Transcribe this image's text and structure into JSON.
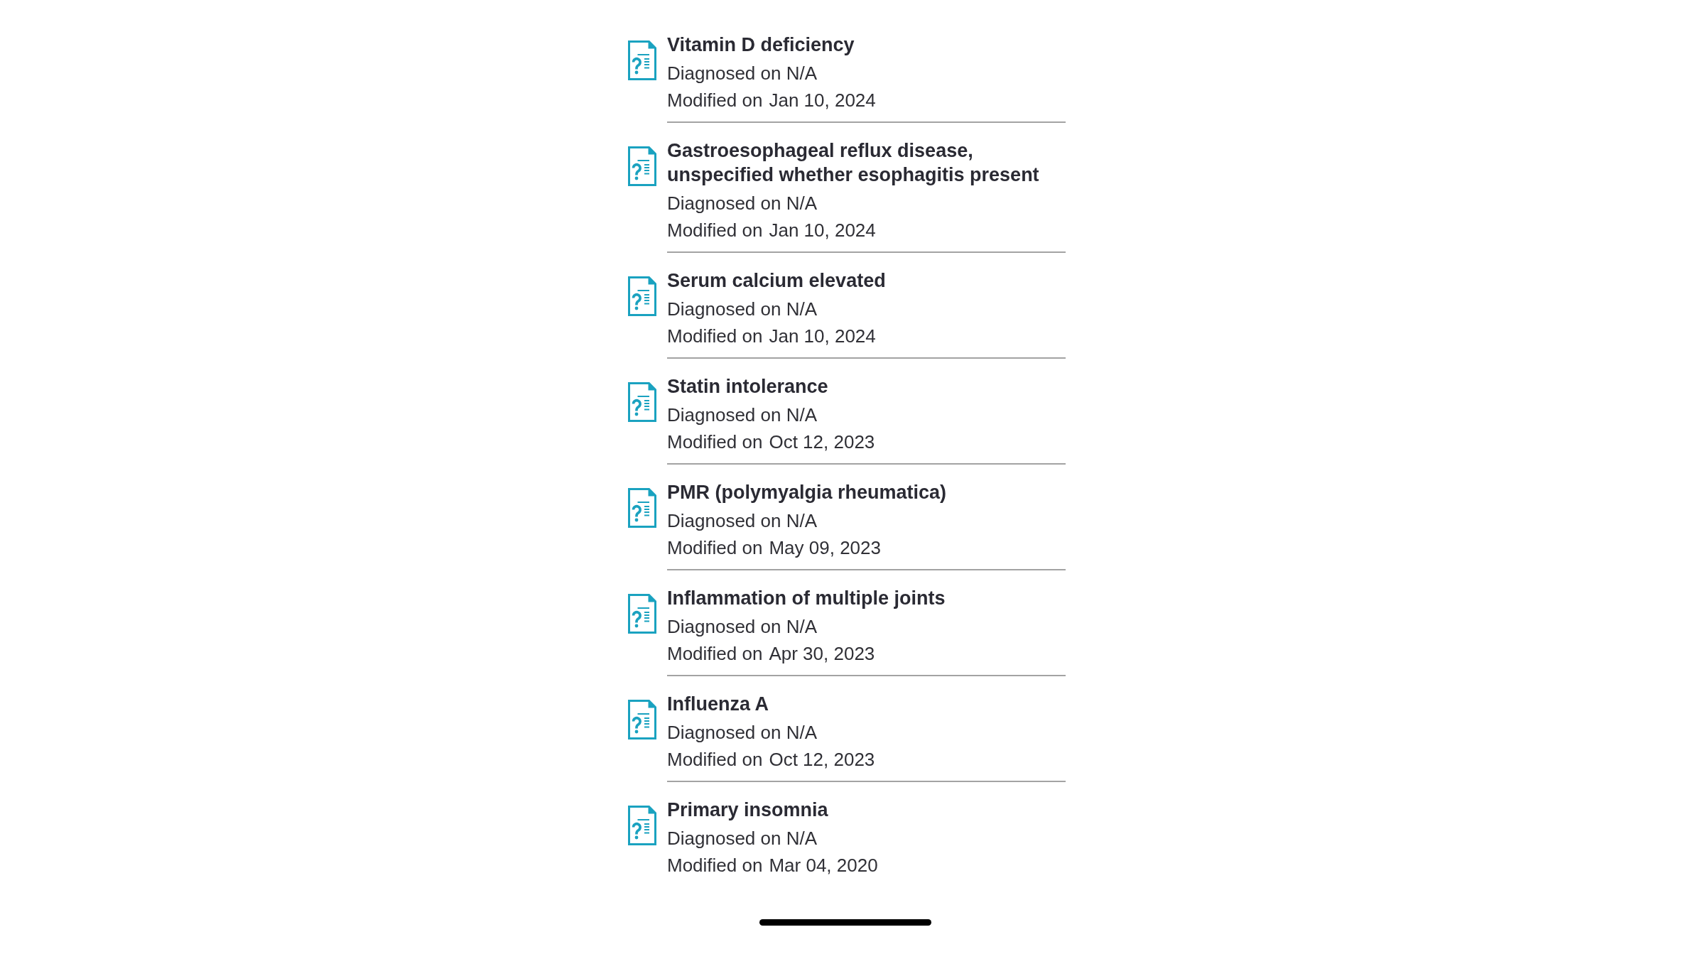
{
  "conditions": [
    {
      "title": "Vitamin D deficiency",
      "diagnosed": "Diagnosed on N/A",
      "modified_label": "Modified on",
      "modified_date": "Jan 10, 2024"
    },
    {
      "title": "Gastroesophageal reflux disease, unspecified whether esophagitis present",
      "diagnosed": "Diagnosed on N/A",
      "modified_label": "Modified on",
      "modified_date": "Jan 10, 2024"
    },
    {
      "title": "Serum calcium elevated",
      "diagnosed": "Diagnosed on N/A",
      "modified_label": "Modified on",
      "modified_date": "Jan 10, 2024"
    },
    {
      "title": "Statin intolerance",
      "diagnosed": "Diagnosed on N/A",
      "modified_label": "Modified on",
      "modified_date": "Oct 12, 2023"
    },
    {
      "title": "PMR (polymyalgia rheumatica)",
      "diagnosed": "Diagnosed on N/A",
      "modified_label": "Modified on",
      "modified_date": "May 09, 2023"
    },
    {
      "title": "Inflammation of multiple joints",
      "diagnosed": "Diagnosed on N/A",
      "modified_label": "Modified on",
      "modified_date": "Apr 30, 2023"
    },
    {
      "title": "Influenza A",
      "diagnosed": "Diagnosed on N/A",
      "modified_label": "Modified on",
      "modified_date": "Oct 12, 2023"
    },
    {
      "title": "Primary insomnia",
      "diagnosed": "Diagnosed on N/A",
      "modified_label": "Modified on",
      "modified_date": "Mar 04, 2020"
    }
  ]
}
